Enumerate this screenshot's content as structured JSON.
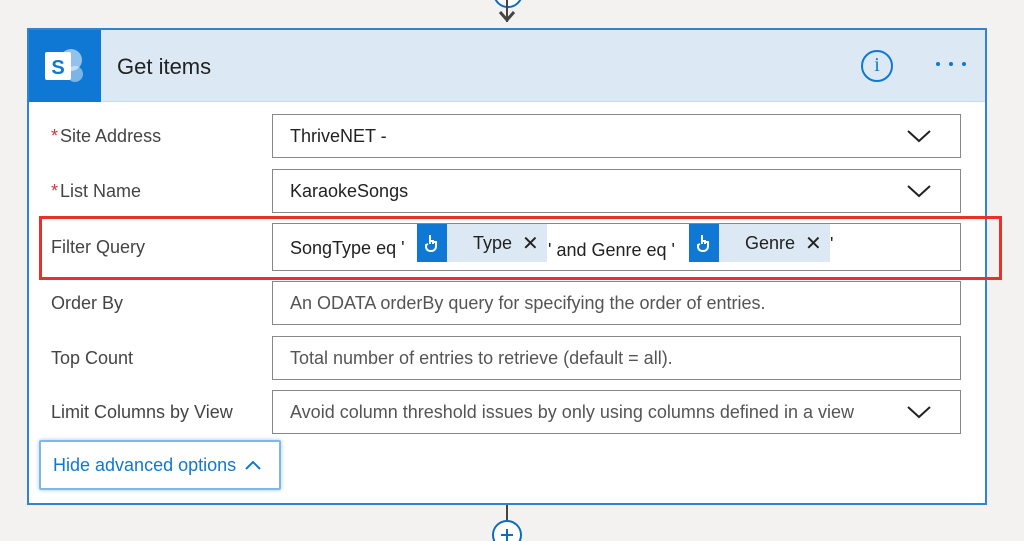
{
  "action": {
    "title": "Get items",
    "icon": "sharepoint-icon",
    "info_icon": "info-icon",
    "info_glyph": "i",
    "more_icon": "ellipsis-icon"
  },
  "fields": {
    "site_address": {
      "label": "Site Address",
      "required": "*",
      "value": "ThriveNET -"
    },
    "list_name": {
      "label": "List Name",
      "required": "*",
      "value": "KaraokeSongs"
    },
    "filter_query": {
      "label": "Filter Query",
      "prefix": "SongType eq '",
      "token1": "Type",
      "middle": "' and Genre eq '",
      "token2": "Genre",
      "suffix": "'",
      "remove_glyph": "✕"
    },
    "order_by": {
      "label": "Order By",
      "placeholder": "An ODATA orderBy query for specifying the order of entries."
    },
    "top_count": {
      "label": "Top Count",
      "placeholder": "Total number of entries to retrieve (default = all)."
    },
    "limit_columns": {
      "label": "Limit Columns by View",
      "placeholder": "Avoid column threshold issues by only using columns defined in a view"
    }
  },
  "advanced_toggle": {
    "label": "Hide advanced options"
  },
  "colors": {
    "accent": "#0f78d4",
    "header_bg": "#dce9f4",
    "highlight": "#e8312a",
    "required": "#d13438"
  }
}
